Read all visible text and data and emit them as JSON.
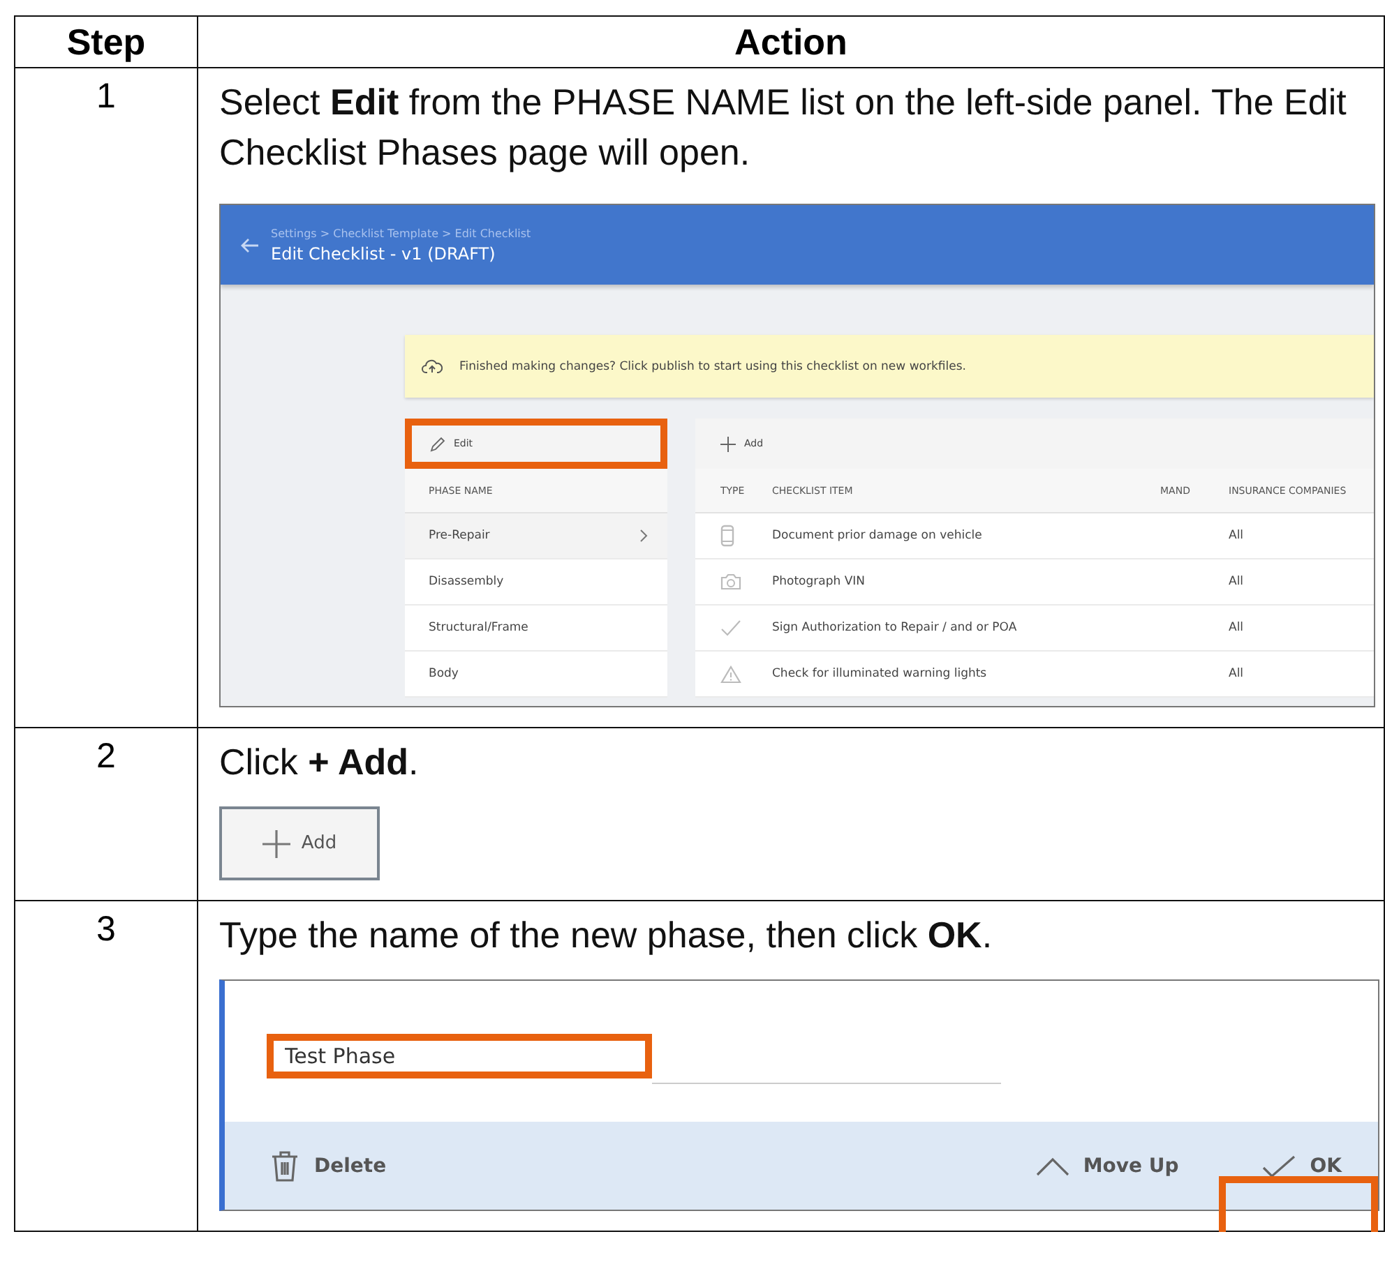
{
  "table": {
    "columns": [
      "Step",
      "Action"
    ],
    "rows": [
      {
        "step": "1",
        "instruction": "Select **Edit** from the PHASE NAME list on the left-side panel. The Edit Checklist Phases page will open.",
        "screenshot": {
          "kind": "checklist_editor",
          "breadcrumb": "Settings > Checklist Template > Edit Checklist",
          "title": "Edit Checklist - v1 (DRAFT)",
          "banner": "Finished making changes? Click publish to start using this checklist on new workfiles.",
          "edit_button": {
            "label": "Edit",
            "highlighted": true
          },
          "phase_header": "PHASE NAME",
          "phases": [
            {
              "name": "Pre-Repair",
              "selected": true
            },
            {
              "name": "Disassembly",
              "selected": false
            },
            {
              "name": "Structural/Frame",
              "selected": false
            },
            {
              "name": "Body",
              "selected": false
            }
          ],
          "add_label": "Add",
          "columns": [
            "TYPE",
            "CHECKLIST ITEM",
            "MAND",
            "INSURANCE COMPANIES"
          ],
          "items": [
            {
              "kind": "phone",
              "text": "Document prior damage on vehicle",
              "companies": "All"
            },
            {
              "kind": "camera",
              "text": "Photograph VIN",
              "companies": "All"
            },
            {
              "kind": "check",
              "text": "Sign Authorization to Repair / and or POA",
              "companies": "All"
            },
            {
              "kind": "warning",
              "text": "Check for illuminated warning lights",
              "companies": "All"
            }
          ]
        }
      },
      {
        "step": "2",
        "instruction": "Click **+ Add**.",
        "screenshot": {
          "kind": "add_button",
          "label": "Add"
        }
      },
      {
        "step": "3",
        "instruction": "Type the name of the new phase, then click **OK**.",
        "screenshot": {
          "kind": "phase_editor",
          "field": {
            "value": "Test Phase",
            "highlighted": true
          },
          "buttons": [
            {
              "kind": "delete",
              "label": "Delete"
            },
            {
              "kind": "move_up",
              "label": "Move Up"
            },
            {
              "kind": "ok",
              "label": "OK"
            }
          ]
        }
      }
    ]
  }
}
